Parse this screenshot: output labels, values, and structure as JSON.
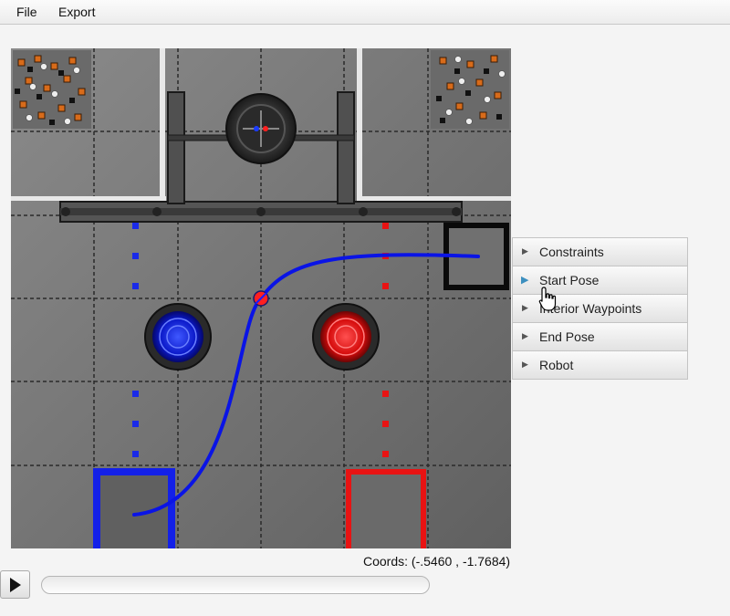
{
  "menu": {
    "file_label": "File",
    "export_label": "Export"
  },
  "panel": {
    "sections": [
      {
        "label": "Constraints",
        "expanded": false
      },
      {
        "label": "Start Pose",
        "expanded": false,
        "hovered": true
      },
      {
        "label": "Interior Waypoints",
        "expanded": false
      },
      {
        "label": "End Pose",
        "expanded": false
      },
      {
        "label": "Robot",
        "expanded": false
      }
    ]
  },
  "status": {
    "coords_text": "Coords: (-.5460 , -1.7684)"
  },
  "playback": {
    "play_icon": "play-icon",
    "progress": 0.0
  },
  "field": {
    "path_color": "#0a14e6",
    "blue_alliance_color": "#1320e8",
    "red_alliance_color": "#e81313",
    "waypoint_color": "#ff2020"
  }
}
